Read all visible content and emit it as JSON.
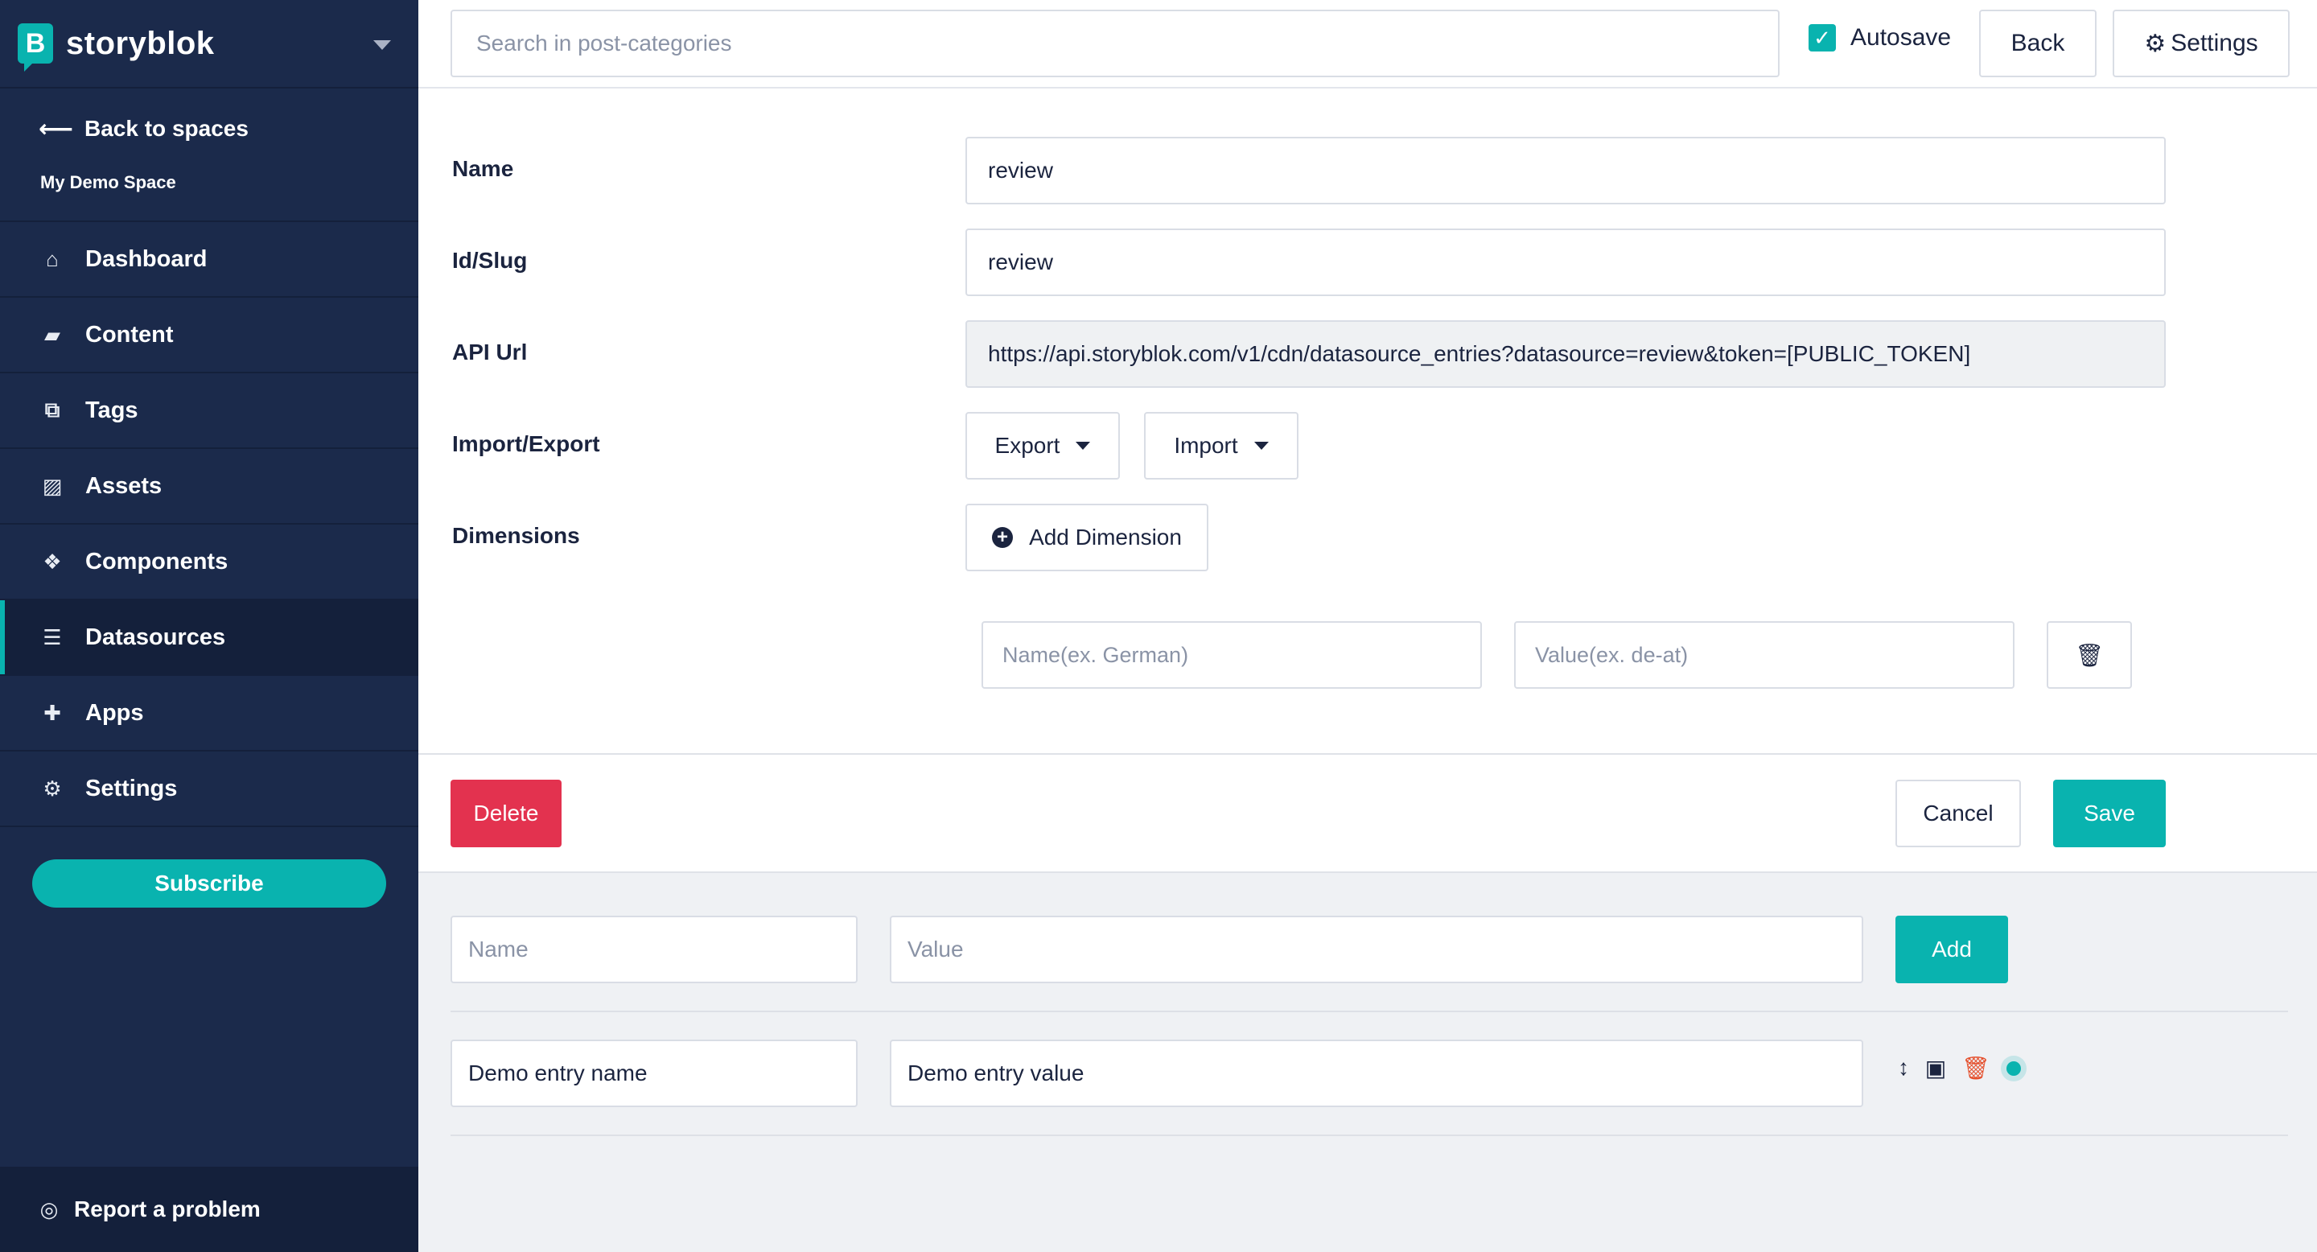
{
  "sidebar": {
    "brand": "storyblok",
    "back_label": "Back to spaces",
    "space_name": "My Demo Space",
    "nav": [
      {
        "label": "Dashboard",
        "icon": "home-icon",
        "glyph": "⌂"
      },
      {
        "label": "Content",
        "icon": "folder-icon",
        "glyph": "▰"
      },
      {
        "label": "Tags",
        "icon": "tags-icon",
        "glyph": "⧉"
      },
      {
        "label": "Assets",
        "icon": "image-icon",
        "glyph": "▨"
      },
      {
        "label": "Components",
        "icon": "cubes-icon",
        "glyph": "❖"
      },
      {
        "label": "Datasources",
        "icon": "database-icon",
        "glyph": "☰"
      },
      {
        "label": "Apps",
        "icon": "puzzle-icon",
        "glyph": "✚"
      },
      {
        "label": "Settings",
        "icon": "gear-icon",
        "glyph": "⚙"
      }
    ],
    "active_item": "Datasources",
    "subscribe_label": "Subscribe",
    "report_label": "Report a problem"
  },
  "topbar": {
    "search_placeholder": "Search in post-categories",
    "autosave_label": "Autosave",
    "autosave_checked": true,
    "back_label": "Back",
    "settings_label": "Settings"
  },
  "form": {
    "name_label": "Name",
    "name_value": "review",
    "slug_label": "Id/Slug",
    "slug_value": "review",
    "api_label": "API Url",
    "api_value": "https://api.storyblok.com/v1/cdn/datasource_entries?datasource=review&token=[PUBLIC_TOKEN]",
    "import_export_label": "Import/Export",
    "export_label": "Export",
    "import_label": "Import",
    "dimensions_label": "Dimensions",
    "add_dimension_label": "Add Dimension",
    "dim_name_placeholder": "Name(ex. German)",
    "dim_value_placeholder": "Value(ex. de-at)",
    "delete_label": "Delete",
    "cancel_label": "Cancel",
    "save_label": "Save"
  },
  "entries": {
    "new_name_placeholder": "Name",
    "new_value_placeholder": "Value",
    "add_label": "Add",
    "rows": [
      {
        "name": "Demo entry name",
        "value": "Demo entry value"
      }
    ]
  },
  "colors": {
    "sidebar_bg": "#1b2a4b",
    "accent": "#09b3af",
    "danger": "#e3324f"
  }
}
